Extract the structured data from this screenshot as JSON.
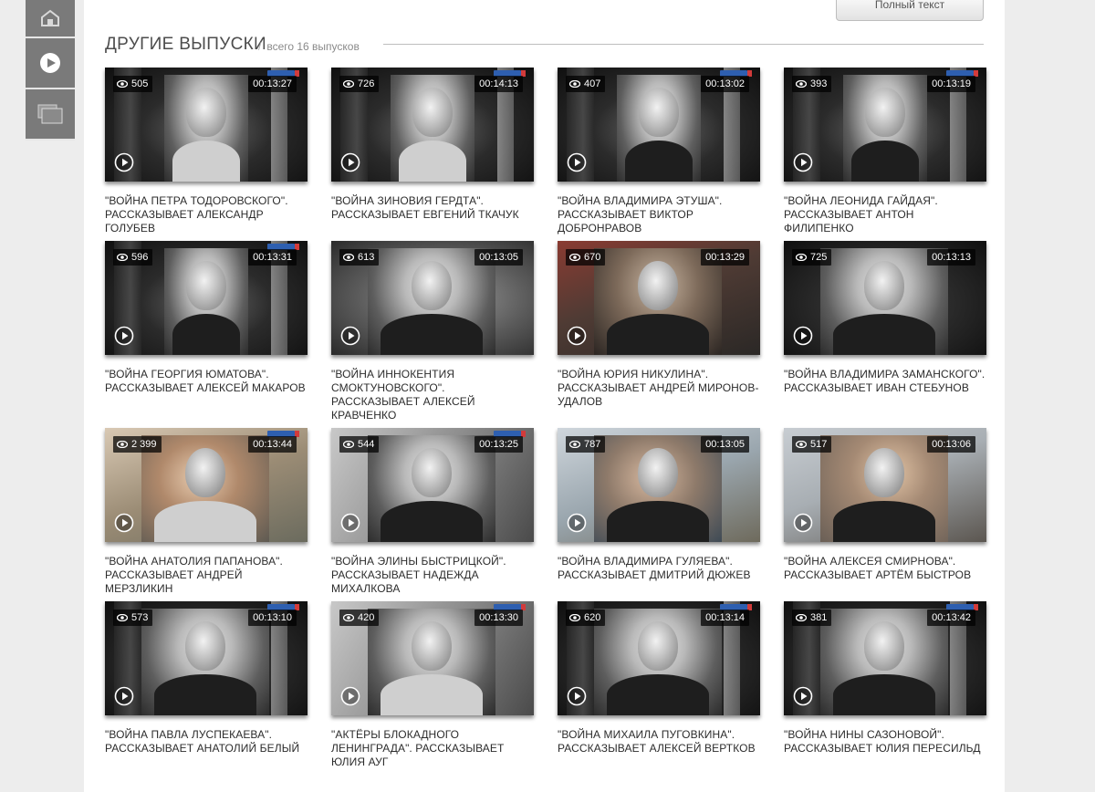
{
  "side_nav": {
    "items": [
      {
        "icon": "home-icon"
      },
      {
        "icon": "play-icon"
      },
      {
        "icon": "folder-icon"
      }
    ]
  },
  "header": {
    "full_text_button": "Полный текст"
  },
  "section": {
    "title": "ДРУГИЕ ВЫПУСКИ",
    "count_text": "всего 16 выпусков"
  },
  "episodes": [
    {
      "views": "505",
      "duration": "00:13:27",
      "title": "\"Война Петра Тодоровского\". Рассказывает Александр Голубев"
    },
    {
      "views": "726",
      "duration": "00:14:13",
      "title": "\"Война Зиновия Гердта\". Рассказывает Евгений Ткачук"
    },
    {
      "views": "407",
      "duration": "00:13:02",
      "title": "\"Война Владимира Этуша\". Рассказывает Виктор Добронравов"
    },
    {
      "views": "393",
      "duration": "00:13:19",
      "title": "\"Война Леонида Гайдая\". Рассказывает Антон Филипенко"
    },
    {
      "views": "596",
      "duration": "00:13:31",
      "title": "\"Война Георгия Юматова\". Рассказывает Алексей Макаров"
    },
    {
      "views": "613",
      "duration": "00:13:05",
      "title": "\"Война Иннокентия Смоктуновского\". Рассказывает Алексей Кравченко"
    },
    {
      "views": "670",
      "duration": "00:13:29",
      "title": "\"Война Юрия Никулина\". Рассказывает Андрей Миронов-Удалов"
    },
    {
      "views": "725",
      "duration": "00:13:13",
      "title": "\"Война Владимира Заманского\". Рассказывает Иван Стебунов"
    },
    {
      "views": "2 399",
      "duration": "00:13:44",
      "title": "\"Война Анатолия Папанова\". Рассказывает Андрей Мерзликин"
    },
    {
      "views": "544",
      "duration": "00:13:25",
      "title": "\"Война Элины Быстрицкой\". Рассказывает Надежда Михалкова"
    },
    {
      "views": "787",
      "duration": "00:13:05",
      "title": "\"Война Владимира Гуляева\". Рассказывает Дмитрий Дюжев"
    },
    {
      "views": "517",
      "duration": "00:13:06",
      "title": "\"Война Алексея Смирнова\". Рассказывает Артём Быстров"
    },
    {
      "views": "573",
      "duration": "00:13:10",
      "title": "\"Война Павла Луспекаева\". Рассказывает Анатолий Белый"
    },
    {
      "views": "420",
      "duration": "00:13:30",
      "title": "\"Актёры блокадного Ленинграда\". Рассказывает Юлия Ауг"
    },
    {
      "views": "620",
      "duration": "00:13:14",
      "title": "\"Война Михаила Пуговкина\". Рассказывает Алексей Вертков"
    },
    {
      "views": "381",
      "duration": "00:13:42",
      "title": "\"Война Нины Сазоновой\". Рассказывает Юлия Пересильд"
    }
  ]
}
